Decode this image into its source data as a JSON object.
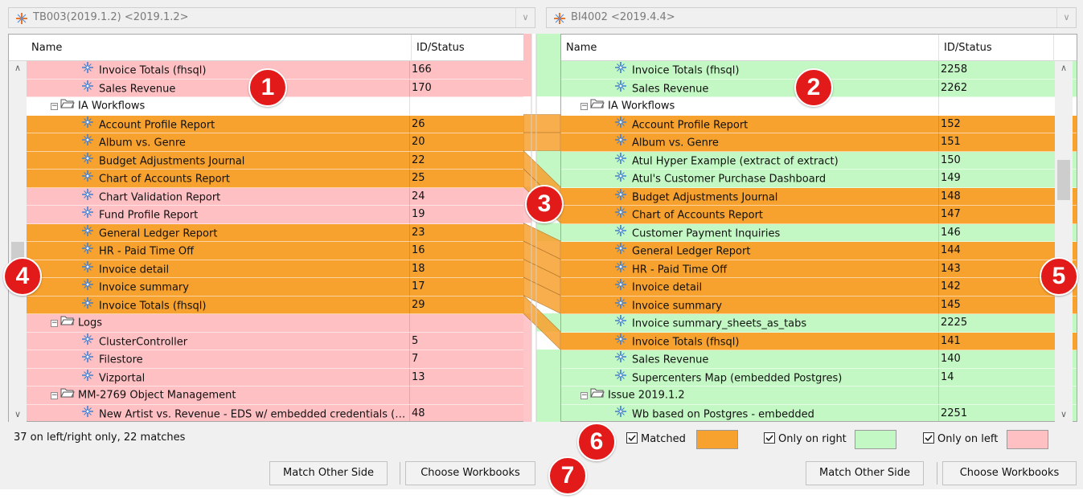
{
  "left_combo": {
    "value": "TB003(2019.1.2) <2019.1.2>"
  },
  "right_combo": {
    "value": "BI4002 <2019.4.4>"
  },
  "left_table": {
    "columns": [
      "Name",
      "ID/Status"
    ],
    "rows": [
      {
        "type": "item",
        "status": "left-only",
        "name": "Invoice Totals (fhsql)",
        "id": "166"
      },
      {
        "type": "item",
        "status": "left-only",
        "name": "Sales Revenue",
        "id": "170"
      },
      {
        "type": "folder",
        "status": "folder",
        "name": "IA Workflows",
        "id": ""
      },
      {
        "type": "item",
        "status": "matched",
        "name": "Account Profile Report",
        "id": "26"
      },
      {
        "type": "item",
        "status": "matched",
        "name": "Album vs. Genre",
        "id": "20"
      },
      {
        "type": "item",
        "status": "matched",
        "name": "Budget Adjustments Journal",
        "id": "22"
      },
      {
        "type": "item",
        "status": "matched",
        "name": "Chart of Accounts Report",
        "id": "25"
      },
      {
        "type": "item",
        "status": "left-only",
        "name": "Chart Validation Report",
        "id": "24"
      },
      {
        "type": "item",
        "status": "left-only",
        "name": "Fund Profile Report",
        "id": "19"
      },
      {
        "type": "item",
        "status": "matched",
        "name": "General Ledger Report",
        "id": "23"
      },
      {
        "type": "item",
        "status": "matched",
        "name": "HR - Paid Time Off",
        "id": "16"
      },
      {
        "type": "item",
        "status": "matched",
        "name": "Invoice detail",
        "id": "18"
      },
      {
        "type": "item",
        "status": "matched",
        "name": "Invoice summary",
        "id": "17"
      },
      {
        "type": "item",
        "status": "matched",
        "name": "Invoice Totals (fhsql)",
        "id": "29"
      },
      {
        "type": "folder",
        "status": "left-only",
        "name": "Logs",
        "id": ""
      },
      {
        "type": "item",
        "status": "left-only",
        "name": "ClusterController",
        "id": "5"
      },
      {
        "type": "item",
        "status": "left-only",
        "name": "Filestore",
        "id": "7"
      },
      {
        "type": "item",
        "status": "left-only",
        "name": "Vizportal",
        "id": "13"
      },
      {
        "type": "folder",
        "status": "left-only",
        "name": "MM-2769 Object Management",
        "id": ""
      },
      {
        "type": "item",
        "status": "left-only",
        "name": "New Artist vs. Revenue - EDS w/ embedded credentials (…",
        "id": "48"
      }
    ]
  },
  "right_table": {
    "columns": [
      "Name",
      "ID/Status"
    ],
    "rows": [
      {
        "type": "item",
        "status": "right-only",
        "name": "Invoice Totals (fhsql)",
        "id": "2258"
      },
      {
        "type": "item",
        "status": "right-only",
        "name": "Sales Revenue",
        "id": "2262"
      },
      {
        "type": "folder",
        "status": "folder",
        "name": "IA Workflows",
        "id": ""
      },
      {
        "type": "item",
        "status": "matched",
        "name": "Account Profile Report",
        "id": "152"
      },
      {
        "type": "item",
        "status": "matched",
        "name": "Album vs. Genre",
        "id": "151"
      },
      {
        "type": "item",
        "status": "right-only",
        "name": "Atul Hyper Example (extract of extract)",
        "id": "150"
      },
      {
        "type": "item",
        "status": "right-only",
        "name": "Atul's Customer Purchase Dashboard",
        "id": "149"
      },
      {
        "type": "item",
        "status": "matched",
        "name": "Budget Adjustments Journal",
        "id": "148"
      },
      {
        "type": "item",
        "status": "matched",
        "name": "Chart of Accounts Report",
        "id": "147"
      },
      {
        "type": "item",
        "status": "right-only",
        "name": "Customer Payment Inquiries",
        "id": "146"
      },
      {
        "type": "item",
        "status": "matched",
        "name": "General Ledger Report",
        "id": "144"
      },
      {
        "type": "item",
        "status": "matched",
        "name": "HR - Paid Time Off",
        "id": "143"
      },
      {
        "type": "item",
        "status": "matched",
        "name": "Invoice detail",
        "id": "142"
      },
      {
        "type": "item",
        "status": "matched",
        "name": "Invoice summary",
        "id": "145"
      },
      {
        "type": "item",
        "status": "right-only",
        "name": "Invoice summary_sheets_as_tabs",
        "id": "2225"
      },
      {
        "type": "item",
        "status": "matched",
        "name": "Invoice Totals (fhsql)",
        "id": "141"
      },
      {
        "type": "item",
        "status": "right-only",
        "name": "Sales Revenue",
        "id": "140"
      },
      {
        "type": "item",
        "status": "right-only",
        "name": "Supercenters Map (embedded Postgres)",
        "id": "14"
      },
      {
        "type": "folder",
        "status": "right-only",
        "name": "Issue 2019.1.2",
        "id": ""
      },
      {
        "type": "item",
        "status": "right-only",
        "name": "Wb based on Postgres - embedded",
        "id": "2251"
      }
    ]
  },
  "connector_matches": [
    [
      3,
      3
    ],
    [
      4,
      4
    ],
    [
      5,
      7
    ],
    [
      6,
      8
    ],
    [
      9,
      10
    ],
    [
      10,
      11
    ],
    [
      11,
      12
    ],
    [
      12,
      13
    ],
    [
      13,
      15
    ]
  ],
  "left_scroll": {
    "position": 0.55,
    "thumb": 0.09
  },
  "right_scroll": {
    "position": 0.29,
    "thumb": 0.12
  },
  "status": {
    "summary": "37 on left/right only, 22 matches"
  },
  "legend": {
    "matched": {
      "label": "Matched",
      "color": "#f7a12e",
      "checked": true
    },
    "right_only": {
      "label": "Only on right",
      "color": "#c3f7c3",
      "checked": true
    },
    "left_only": {
      "label": "Only on left",
      "color": "#ffc0c4",
      "checked": true
    }
  },
  "buttons": {
    "left_match": "Match Other Side",
    "left_choose": "Choose Workbooks",
    "right_match": "Match Other Side",
    "right_choose": "Choose Workbooks"
  },
  "callouts": [
    "1",
    "2",
    "3",
    "4",
    "5",
    "6",
    "7"
  ],
  "colors": {
    "matched": "#f7a12e",
    "left_only": "#ffc0c4",
    "right_only": "#c3f7c3",
    "callout": "#e21a1a"
  }
}
